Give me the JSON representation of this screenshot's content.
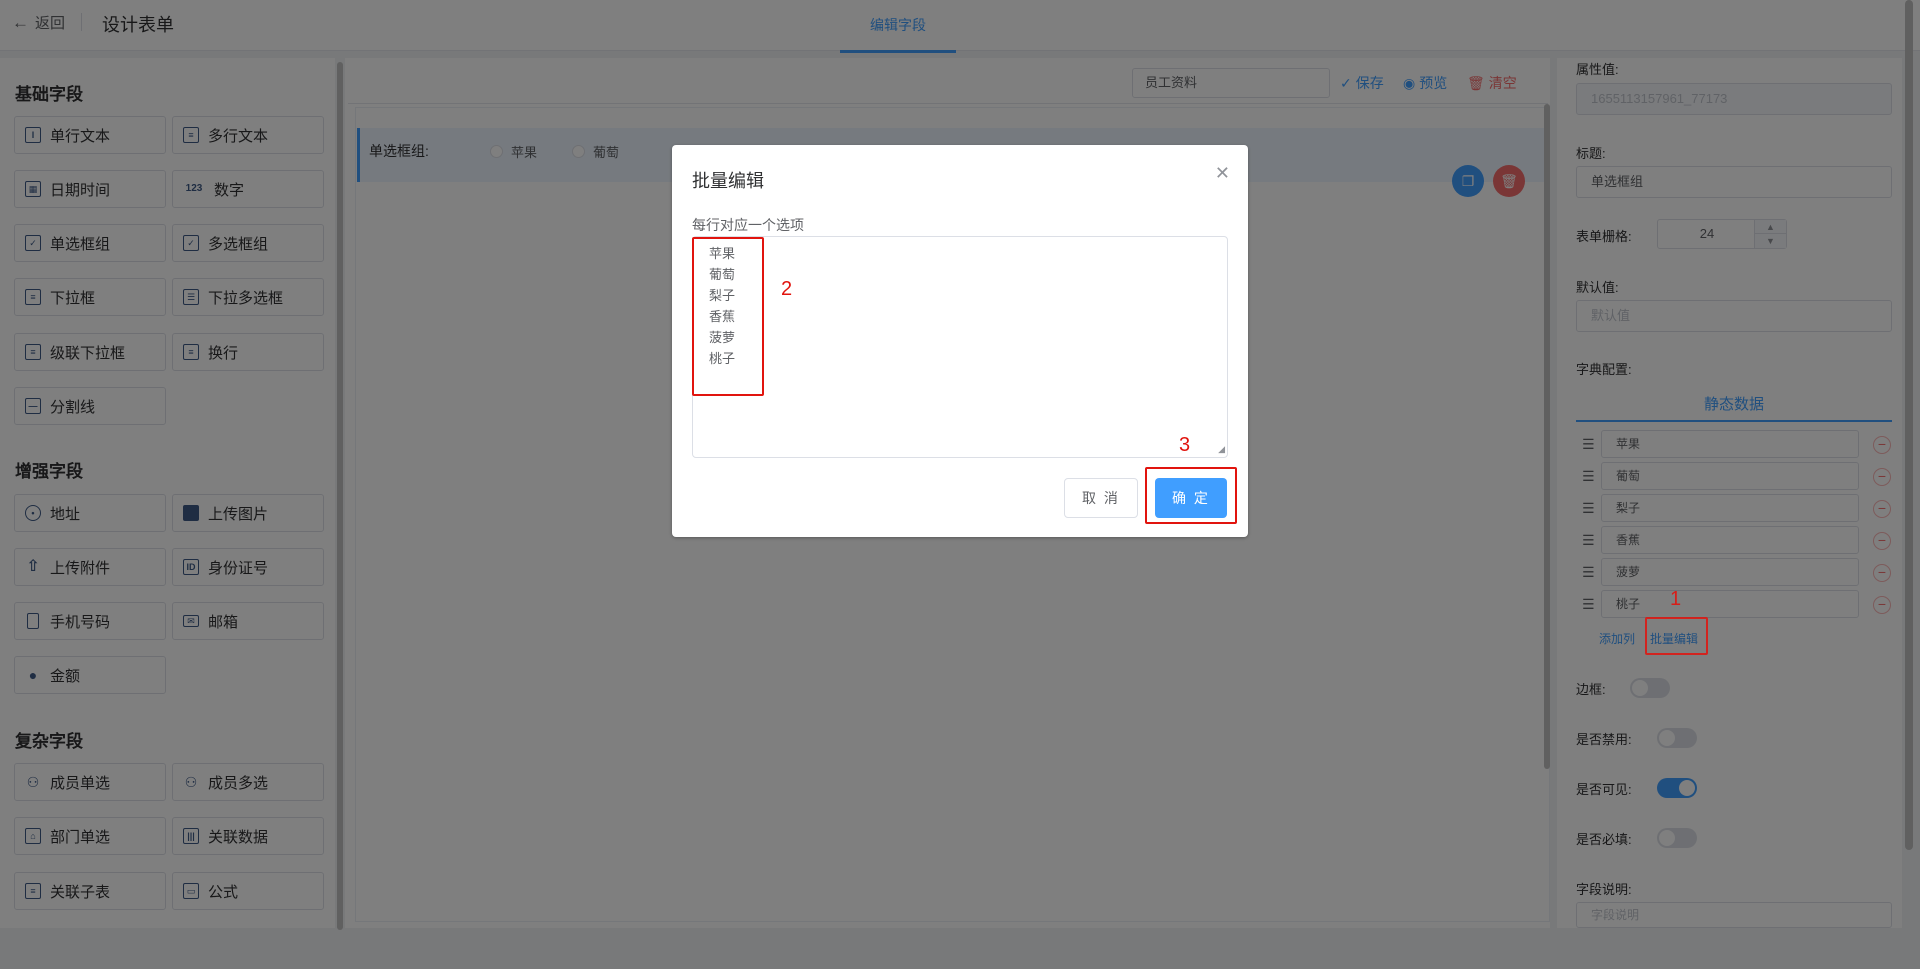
{
  "header": {
    "back_label": "返回",
    "title": "设计表单",
    "tab": "编辑字段"
  },
  "left": {
    "sections": [
      {
        "title": "基础字段",
        "items": [
          {
            "label": "单行文本",
            "icon": "text-input-icon"
          },
          {
            "label": "多行文本",
            "icon": "textarea-icon"
          },
          {
            "label": "日期时间",
            "icon": "calendar-icon"
          },
          {
            "label": "数字",
            "icon": "number-icon"
          },
          {
            "label": "单选框组",
            "icon": "checkbox-icon"
          },
          {
            "label": "多选框组",
            "icon": "multi-checkbox-icon"
          },
          {
            "label": "下拉框",
            "icon": "select-icon"
          },
          {
            "label": "下拉多选框",
            "icon": "multi-select-icon"
          },
          {
            "label": "级联下拉框",
            "icon": "cascade-icon"
          },
          {
            "label": "换行",
            "icon": "newline-icon"
          },
          {
            "label": "分割线",
            "icon": "divider-icon"
          }
        ]
      },
      {
        "title": "增强字段",
        "items": [
          {
            "label": "地址",
            "icon": "location-icon"
          },
          {
            "label": "上传图片",
            "icon": "image-icon"
          },
          {
            "label": "上传附件",
            "icon": "upload-icon"
          },
          {
            "label": "身份证号",
            "icon": "id-card-icon"
          },
          {
            "label": "手机号码",
            "icon": "phone-icon"
          },
          {
            "label": "邮箱",
            "icon": "mail-icon"
          },
          {
            "label": "金额",
            "icon": "money-icon"
          }
        ]
      },
      {
        "title": "复杂字段",
        "items": [
          {
            "label": "成员单选",
            "icon": "user-icon"
          },
          {
            "label": "成员多选",
            "icon": "users-icon"
          },
          {
            "label": "部门单选",
            "icon": "department-icon"
          },
          {
            "label": "关联数据",
            "icon": "relation-icon"
          },
          {
            "label": "关联子表",
            "icon": "subtable-icon"
          },
          {
            "label": "公式",
            "icon": "formula-icon"
          }
        ]
      }
    ]
  },
  "canvas": {
    "form_name": "员工资料",
    "save": "保存",
    "preview": "预览",
    "clear": "清空",
    "field_label": "单选框组:",
    "options": [
      "苹果",
      "葡萄"
    ]
  },
  "right": {
    "value_label": "属性值:",
    "value": "1655113157961_77173",
    "title_label": "标题:",
    "title_value": "单选框组",
    "grid_label": "表单栅格:",
    "grid_value": "24",
    "default_label": "默认值:",
    "default_placeholder": "默认值",
    "dict_label": "字典配置:",
    "dict_tab": "静态数据",
    "options": [
      "苹果",
      "葡萄",
      "梨子",
      "香蕉",
      "菠萝",
      "桃子"
    ],
    "add_col": "添加列",
    "batch_edit": "批量编辑",
    "border_label": "边框:",
    "disabled_label": "是否禁用:",
    "visible_label": "是否可见:",
    "required_label": "是否必填:",
    "desc_label": "字段说明:",
    "desc_placeholder": "字段说明",
    "switches": {
      "border": false,
      "disabled": false,
      "visible": true,
      "required": false
    }
  },
  "dialog": {
    "title": "批量编辑",
    "hint": "每行对应一个选项",
    "lines": [
      "苹果",
      "葡萄",
      "梨子",
      "香蕉",
      "菠萝",
      "桃子"
    ],
    "cancel": "取 消",
    "ok": "确 定"
  },
  "annotations": {
    "n1": "1",
    "n2": "2",
    "n3": "3",
    "color": "#e1140e"
  },
  "colors": {
    "primary": "#409eff",
    "danger": "#f56c6c"
  }
}
